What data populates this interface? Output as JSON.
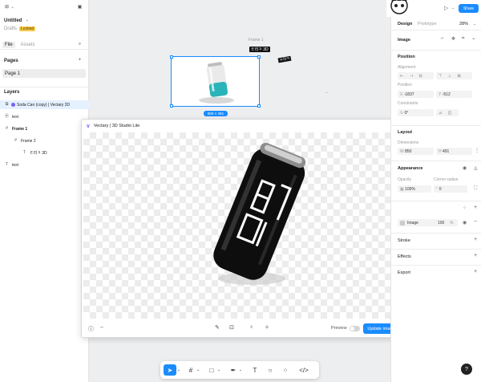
{
  "file": {
    "title": "Untitled",
    "location": "Drafts",
    "badge": "Locked"
  },
  "left_tabs": {
    "file": "File",
    "assets": "Assets"
  },
  "pages": {
    "header": "Pages",
    "items": [
      "Page 1"
    ]
  },
  "layers": {
    "header": "Layers",
    "items": [
      {
        "label": "Soda Can (copy) | Vectary 3D",
        "icon": "vectary-icon"
      },
      {
        "label": "text",
        "icon": "text-icon"
      },
      {
        "label": "Frame 1",
        "icon": "frame-icon"
      },
      {
        "label": "Frame 2",
        "icon": "frame-icon"
      },
      {
        "label": "ㅌ리ㅋ 3D",
        "icon": "text-icon"
      },
      {
        "label": "text",
        "icon": "text-icon"
      }
    ]
  },
  "canvas": {
    "frame_label": "Frame 1",
    "size_badge": "850 × 491",
    "tag1": "ㅌ리ㅋ 3D",
    "tag2": "ㅌ리ㅋ"
  },
  "modal": {
    "title": "Vectary | 3D Studio Lite",
    "preview_label": "Preview",
    "update_button": "Update image",
    "can_text": "ㅌ리ㅋ"
  },
  "right": {
    "share": "Share",
    "tabs": {
      "design": "Design",
      "prototype": "Prototype",
      "zoom": "28%"
    },
    "section_title": "Image",
    "position": {
      "header": "Position",
      "alignment_label": "Alignment",
      "position_label": "Position",
      "x": "-1837",
      "y": "-512",
      "constraints_label": "Constraints",
      "rotation": "0°"
    },
    "layout": {
      "header": "Layout",
      "dimensions_label": "Dimensions",
      "w": "850",
      "h": "491"
    },
    "appearance": {
      "header": "Appearance",
      "opacity_label": "Opacity",
      "radius_label": "Corner radius",
      "opacity": "100%",
      "radius": "0"
    },
    "fill": {
      "label": "Image",
      "value": "100",
      "unit": "%"
    },
    "stroke": "Stroke",
    "effects": "Effects",
    "export": "Export"
  },
  "help": "?",
  "colors": {
    "accent": "#1a8cff",
    "teal": "#2ab3b8",
    "badge": "#f7c948",
    "can": "#111111"
  }
}
